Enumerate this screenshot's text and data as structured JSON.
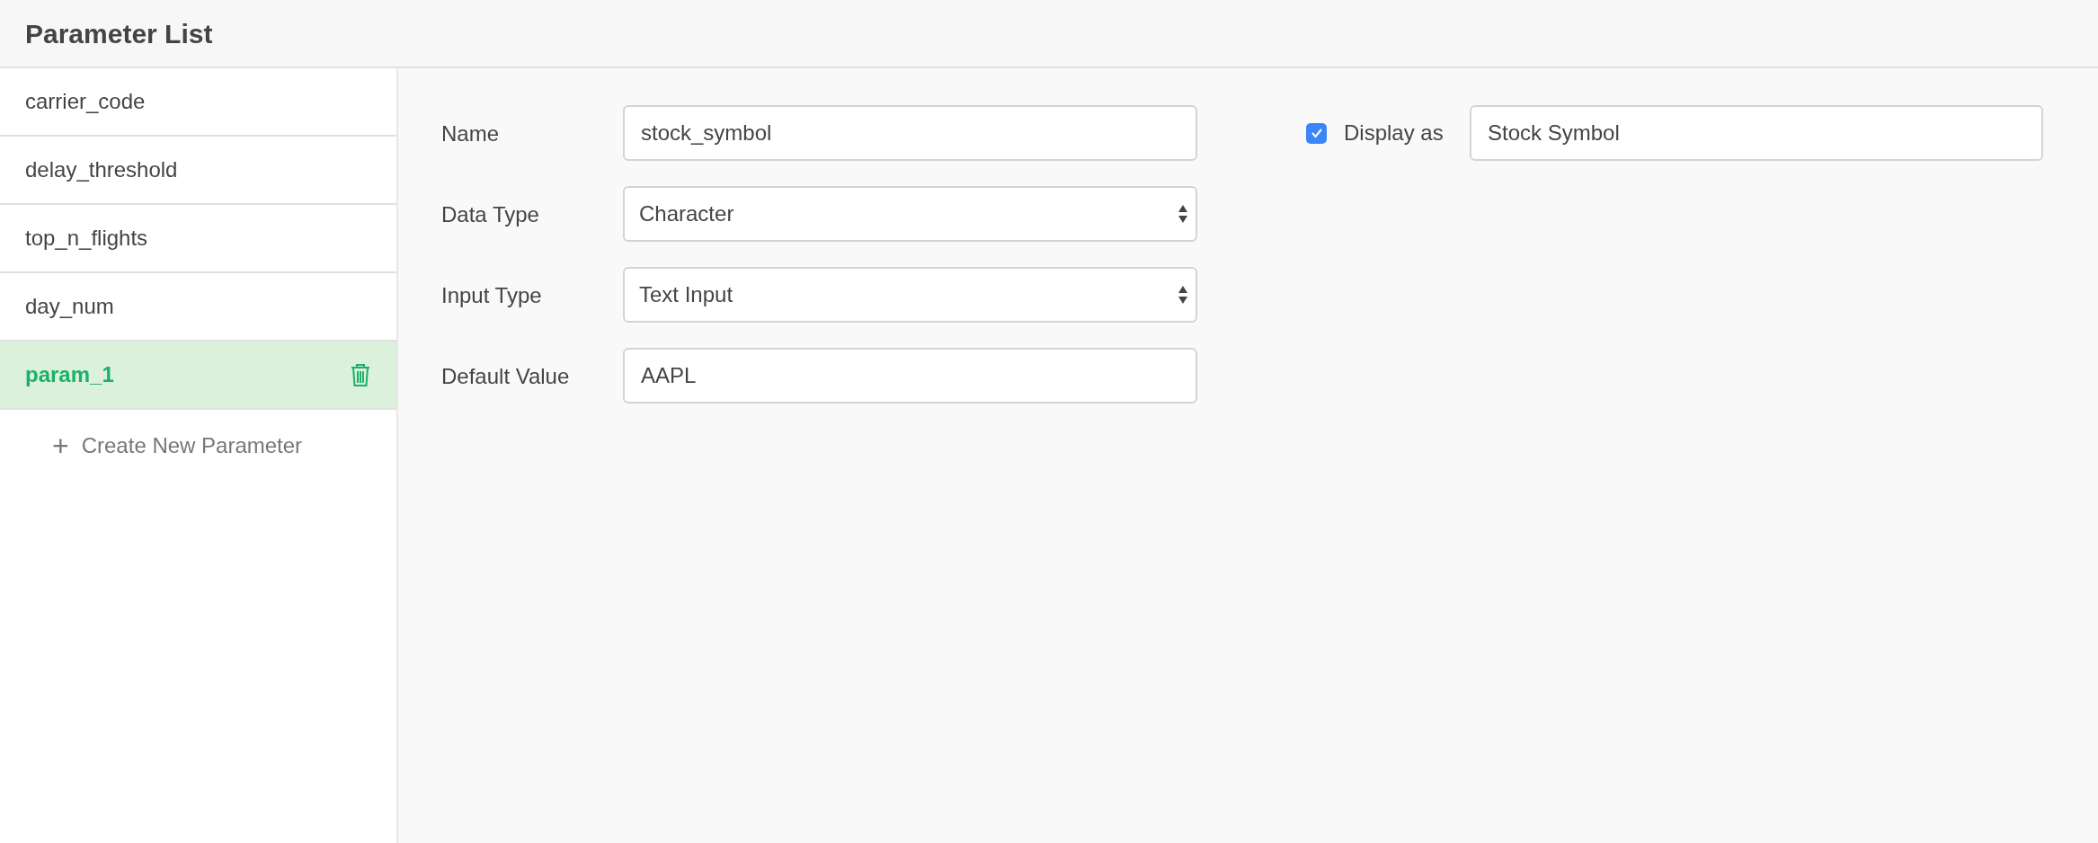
{
  "header": {
    "title": "Parameter List"
  },
  "sidebar": {
    "items": [
      {
        "label": "carrier_code",
        "selected": false
      },
      {
        "label": "delay_threshold",
        "selected": false
      },
      {
        "label": "top_n_flights",
        "selected": false
      },
      {
        "label": "day_num",
        "selected": false
      },
      {
        "label": "param_1",
        "selected": true
      }
    ],
    "create_link": {
      "icon": "+",
      "label": "Create New Parameter"
    }
  },
  "form": {
    "fields": [
      {
        "label": "Name",
        "kind": "text",
        "value": "stock_symbol"
      },
      {
        "label": "Data Type",
        "kind": "select",
        "value": "Character"
      },
      {
        "label": "Input Type",
        "kind": "select",
        "value": "Text Input"
      },
      {
        "label": "Default Value",
        "kind": "text",
        "value": "AAPL"
      }
    ],
    "display_as": {
      "label": "Display as",
      "checked": true,
      "value": "Stock Symbol"
    }
  }
}
